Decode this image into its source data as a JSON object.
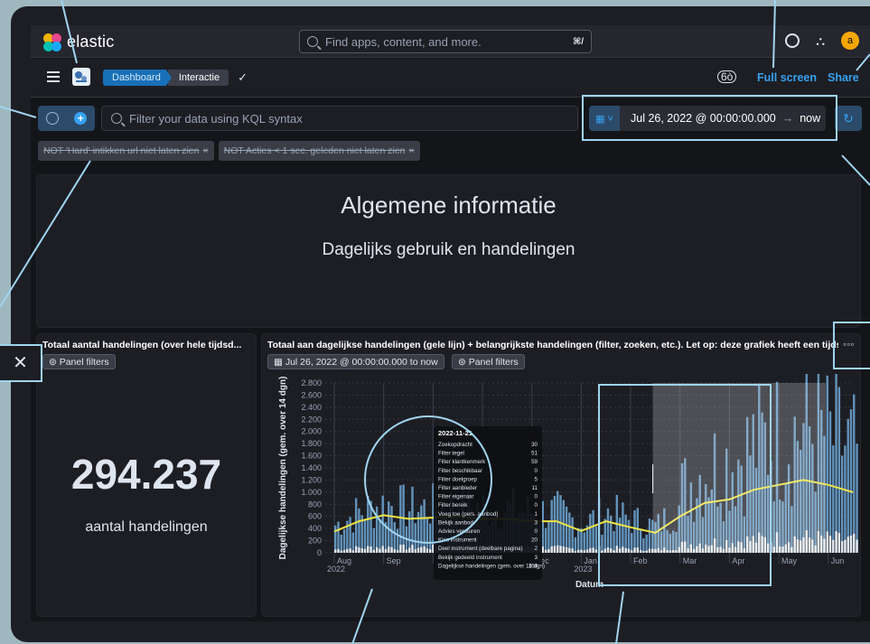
{
  "header": {
    "logo_text": "elastic",
    "search_placeholder": "Find apps, content, and more.",
    "search_shortcut": "⌘/",
    "avatar_initial": "a"
  },
  "toolbar": {
    "breadcrumb": [
      "Dashboard",
      "Interactie"
    ],
    "full_screen_label": "Full screen",
    "share_label": "Share"
  },
  "query": {
    "placeholder": "Filter your data using KQL syntax",
    "date_start": "Jul 26, 2022 @ 00:00:00.000",
    "date_arrow": "→",
    "date_end": "now"
  },
  "filters": [
    "NOT 'Hard' intikken url niet laten zien",
    "NOT Acties < 1 sec. geleden niet laten zien"
  ],
  "markdown_panel": {
    "title": "Algemene informatie",
    "subtitle": "Dagelijks gebruik en handelingen"
  },
  "metric_panel": {
    "title": "Totaal aantal handelingen (over hele tijdsd...",
    "panel_filters_label": "Panel filters",
    "value": "294.237",
    "label": "aantal handelingen"
  },
  "chart_panel": {
    "title": "Totaal aan dagelijkse handelingen (gele lijn) + belangrijkste handelingen (filter, zoeken, etc.). Let op: deze grafiek heeft een tijdsfilter",
    "time_filter_label": "Jul 26, 2022 @ 00:00:00.000 to now",
    "panel_filters_label": "Panel filters"
  },
  "chart_data": {
    "type": "bar",
    "ylabel": "Dagelijkse handelingen (gem. over 14 dgn)",
    "xlabel": "Datum",
    "ylim": [
      0,
      2800
    ],
    "y_ticks": [
      "0",
      "200",
      "400",
      "600",
      "800",
      "1.000",
      "1.200",
      "1.400",
      "1.600",
      "1.800",
      "2.000",
      "2.200",
      "2.400",
      "2.600",
      "2.800"
    ],
    "x_ticks": [
      {
        "label": "Aug",
        "sub": "2022"
      },
      {
        "label": "Sep",
        "sub": ""
      },
      {
        "label": "Oct",
        "sub": ""
      },
      {
        "label": "Nov",
        "sub": ""
      },
      {
        "label": "Dec",
        "sub": ""
      },
      {
        "label": "Jan",
        "sub": "2023"
      },
      {
        "label": "Feb",
        "sub": ""
      },
      {
        "label": "Mar",
        "sub": ""
      },
      {
        "label": "Apr",
        "sub": ""
      },
      {
        "label": "May",
        "sub": ""
      },
      {
        "label": "Jun",
        "sub": ""
      }
    ],
    "line_series_color": "#f0e442",
    "bar_series_color": "#6fa8d6",
    "line_points": [
      [
        0,
        350
      ],
      [
        0.5,
        520
      ],
      [
        1,
        620
      ],
      [
        1.5,
        560
      ],
      [
        2,
        580
      ],
      [
        2.5,
        600
      ],
      [
        3,
        560
      ],
      [
        3.5,
        560
      ],
      [
        4,
        520
      ],
      [
        4.5,
        520
      ],
      [
        5,
        360
      ],
      [
        5.5,
        520
      ],
      [
        6,
        420
      ],
      [
        6.5,
        330
      ],
      [
        7,
        600
      ],
      [
        7.5,
        820
      ],
      [
        8,
        880
      ],
      [
        8.5,
        1040
      ],
      [
        9,
        1120
      ],
      [
        9.5,
        1200
      ],
      [
        10,
        1120
      ],
      [
        10.5,
        1000
      ]
    ],
    "tooltip": {
      "date": "2022-11-21",
      "rows": [
        [
          "Zoekopdracht",
          "30"
        ],
        [
          "Filter tegel",
          "51"
        ],
        [
          "Filter klantkenmerk",
          "59"
        ],
        [
          "Filter beschikbaar",
          "0"
        ],
        [
          "Filter doelgroep",
          "5"
        ],
        [
          "Filter aanbieder",
          "11"
        ],
        [
          "Filter eigenaar",
          "0"
        ],
        [
          "Filter bereik",
          "0"
        ],
        [
          "Voeg toe (pers. aanbod)",
          "1"
        ],
        [
          "Bekijk aanbod",
          "3"
        ],
        [
          "Advies versturen",
          "0"
        ],
        [
          "Kies instrument",
          "20"
        ],
        [
          "Deel instrument (deelbare pagina)",
          "2"
        ],
        [
          "Bekijk gedeeld instrument",
          "3"
        ],
        [
          "Dagelijkse handelingen (gem. over 14 dgn)",
          "168"
        ]
      ]
    }
  }
}
